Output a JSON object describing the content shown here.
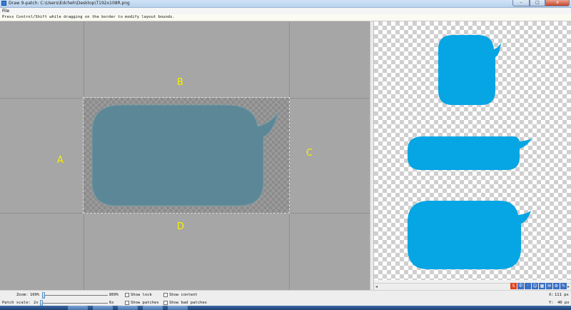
{
  "window": {
    "title": "Draw 9-patch: C:\\Users\\Edcheh\\Desktop\\T192x108R.png",
    "minimize_glyph": "–",
    "maximize_glyph": "□",
    "close_glyph": "x"
  },
  "menu": {
    "file_label": "File"
  },
  "hint": "Press Control/Shift while dragging on the border to modify layout bounds.",
  "editor": {
    "labels": {
      "top": "B",
      "left": "A",
      "right": "C",
      "bottom": "D"
    },
    "bubble_color": "#5b8796"
  },
  "preview": {
    "bubble_color": "#06a5e4"
  },
  "scroll": {
    "left_arrow": "◂",
    "right_arrow": "▸"
  },
  "ime": [
    "S",
    "中",
    "·",
    "☺",
    "▦",
    "✉",
    "⚙",
    "✎"
  ],
  "status": {
    "zoom_label": "Zoom:",
    "zoom_min": "100%",
    "zoom_max": "800%",
    "zoom_value": 0,
    "patch_scale_label": "Patch scale:",
    "patch_scale_min": "2x",
    "patch_scale_max": "6x",
    "patch_scale_value": 0,
    "show_lock": "Show lock",
    "show_content": "Show content",
    "show_patches": "Show patches",
    "show_bad_patches": "Show bad patches",
    "x_label": "X:",
    "x_value": "111 px",
    "y_label": "Y:",
    "y_value": "40 px"
  }
}
